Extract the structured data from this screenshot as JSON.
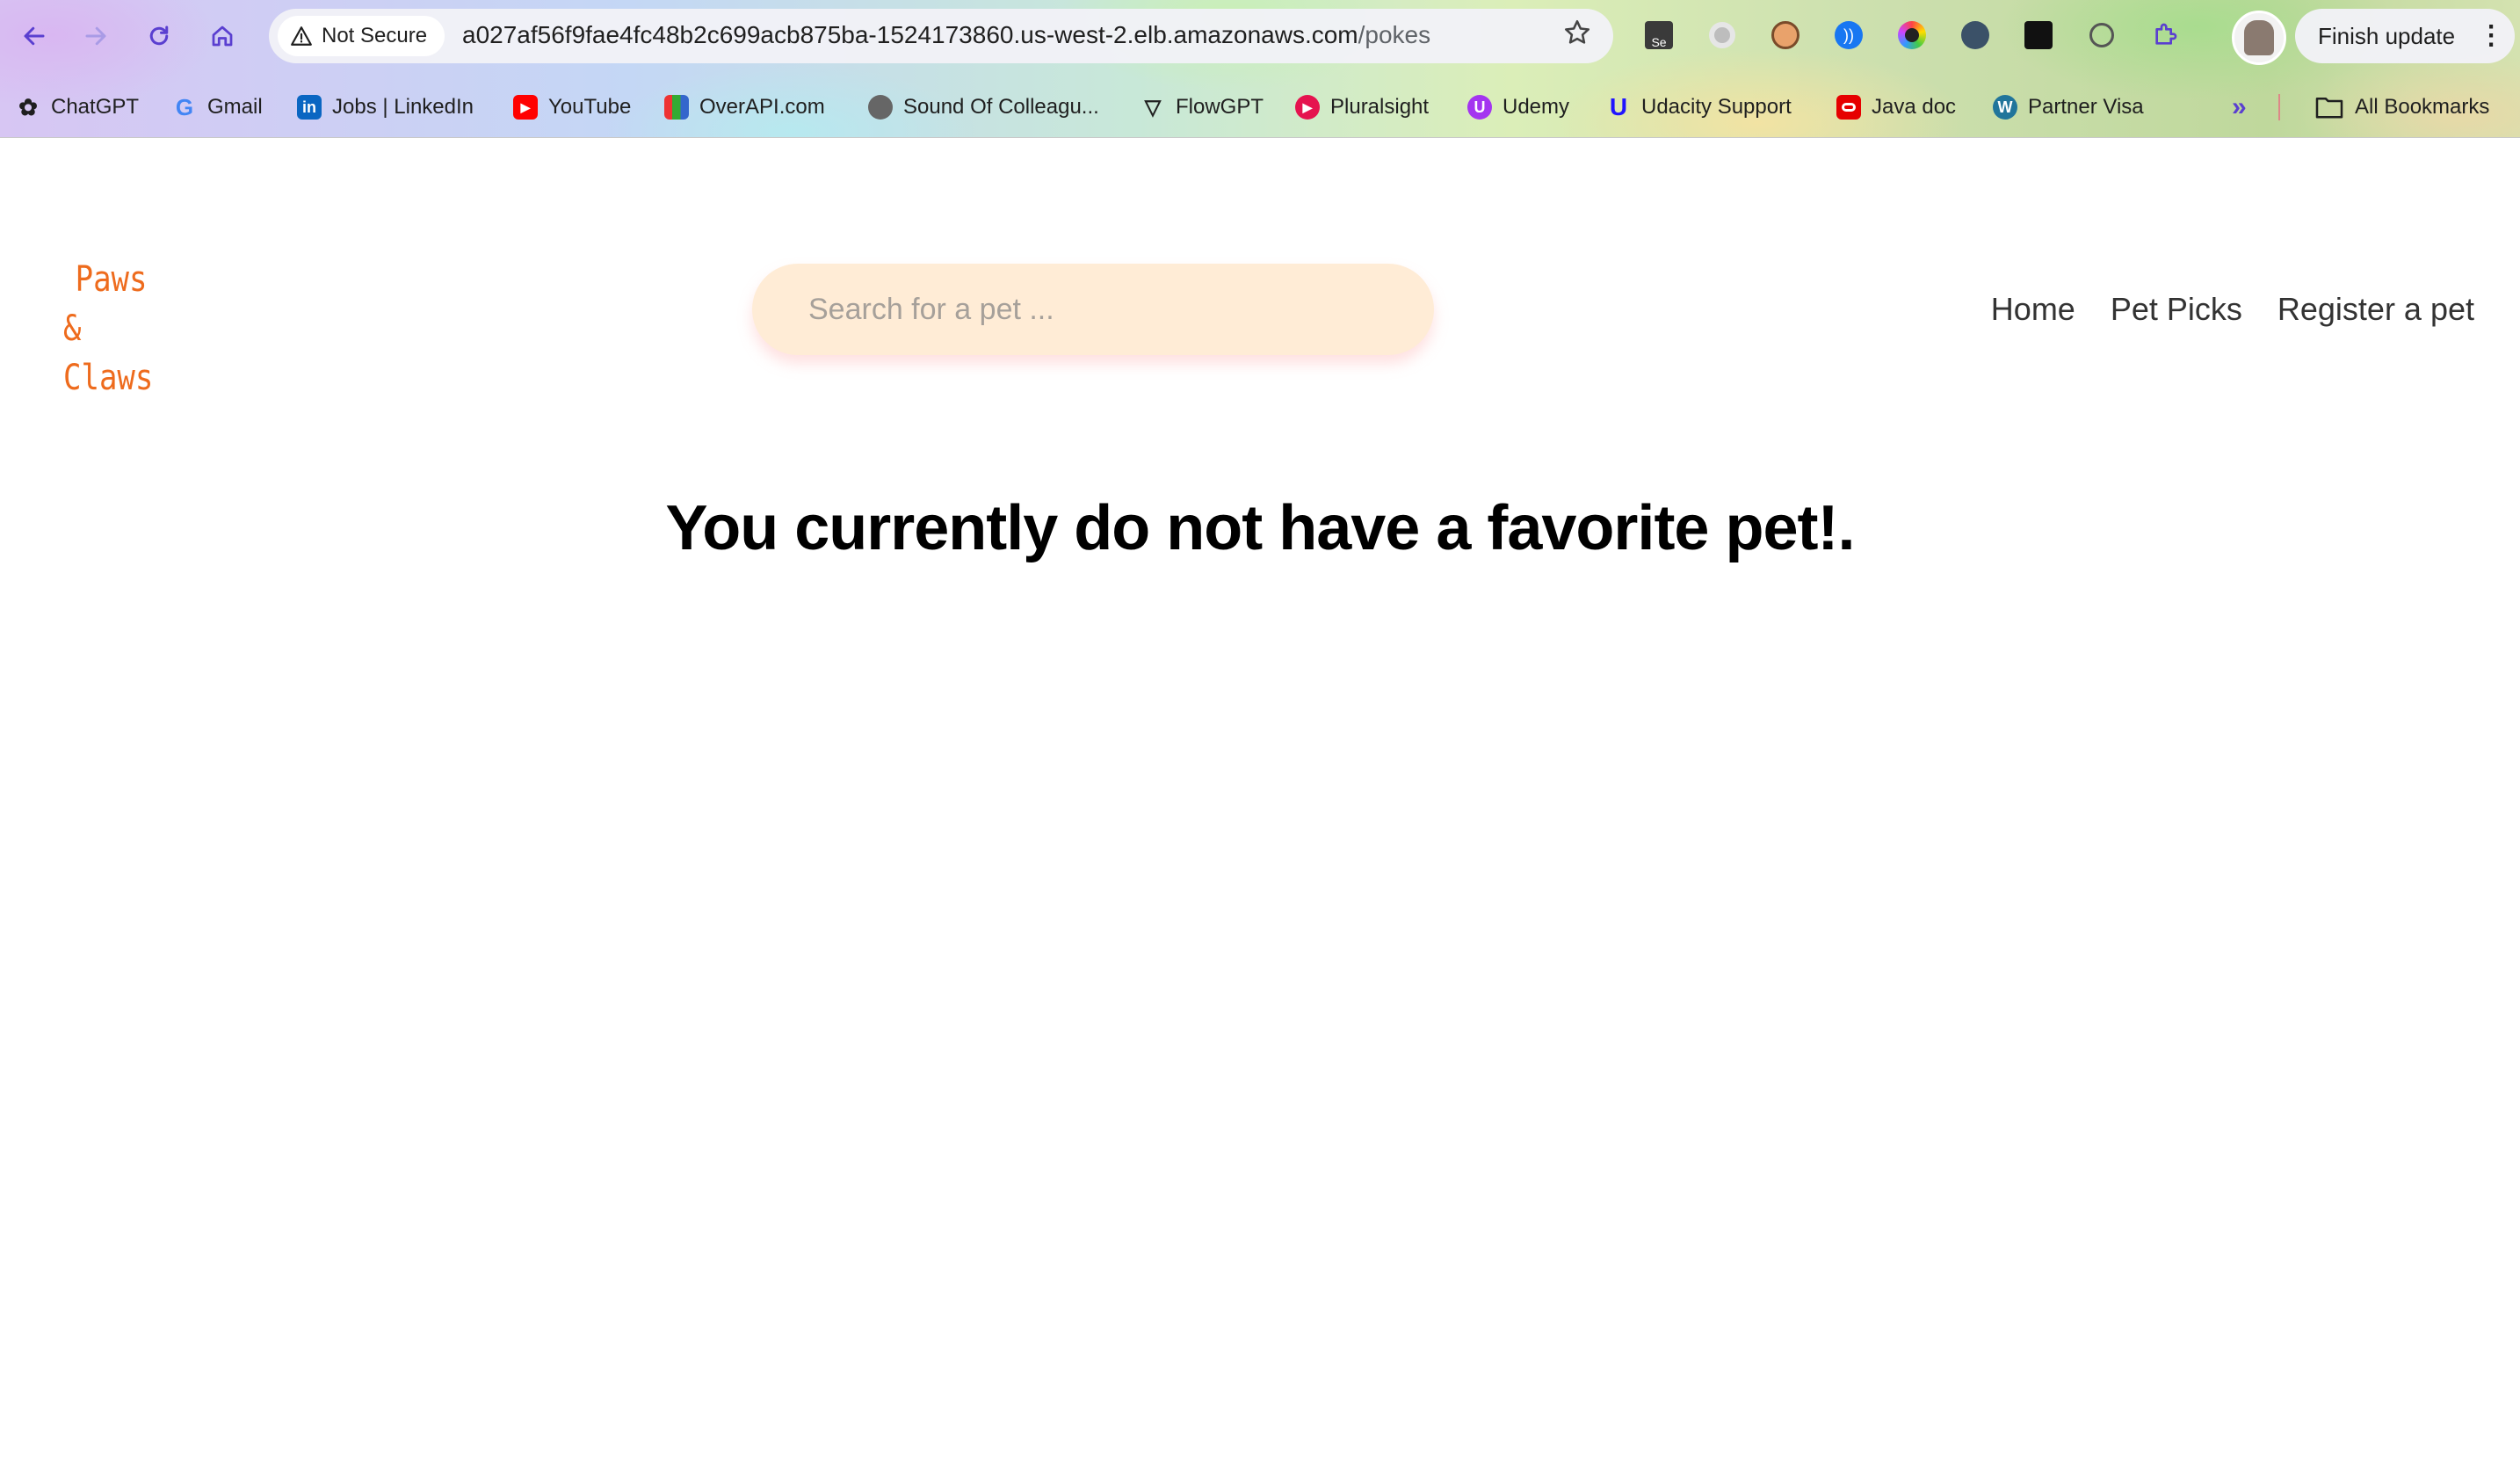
{
  "browser": {
    "security_label": "Not Secure",
    "url_host": "a027af56f9fae4fc48b2c699acb875ba-1524173860.us-west-2.elb.amazonaws.com",
    "url_path": "/pokes",
    "finish_update_label": "Finish update",
    "bookmarks": [
      {
        "label": "ChatGPT",
        "icon": "chatgpt-icon",
        "color": "#1f1f1f"
      },
      {
        "label": "Gmail",
        "icon": "google-icon",
        "color": "#4285f4"
      },
      {
        "label": "Jobs | LinkedIn",
        "icon": "linkedin-icon",
        "color": "#0a66c2"
      },
      {
        "label": "YouTube",
        "icon": "youtube-icon",
        "color": "#ff0000"
      },
      {
        "label": "OverAPI.com",
        "icon": "overapi-icon",
        "color": "#6a3"
      },
      {
        "label": "Sound Of Colleagu...",
        "icon": "globe-icon",
        "color": "#555"
      },
      {
        "label": "FlowGPT",
        "icon": "flowgpt-icon",
        "color": "#222"
      },
      {
        "label": "Pluralsight",
        "icon": "pluralsight-icon",
        "color": "#f15b2a"
      },
      {
        "label": "Udemy",
        "icon": "udemy-icon",
        "color": "#a435f0"
      },
      {
        "label": "Udacity Support",
        "icon": "udacity-icon",
        "color": "#2015ff"
      },
      {
        "label": "Java doc",
        "icon": "oracle-icon",
        "color": "#e60000"
      },
      {
        "label": "Partner Visa",
        "icon": "wordpress-icon",
        "color": "#21759b"
      }
    ],
    "all_bookmarks_label": "All Bookmarks"
  },
  "site": {
    "logo_line1": "Paws",
    "logo_line2": "& Claws",
    "search_placeholder": "Search for a pet ...",
    "nav": {
      "home": "Home",
      "pet_picks": "Pet Picks",
      "register": "Register a pet"
    },
    "message": "You currently do not have a favorite pet!.",
    "accent_color": "#ee6b1d",
    "search_bg_color": "#ffecd6"
  }
}
